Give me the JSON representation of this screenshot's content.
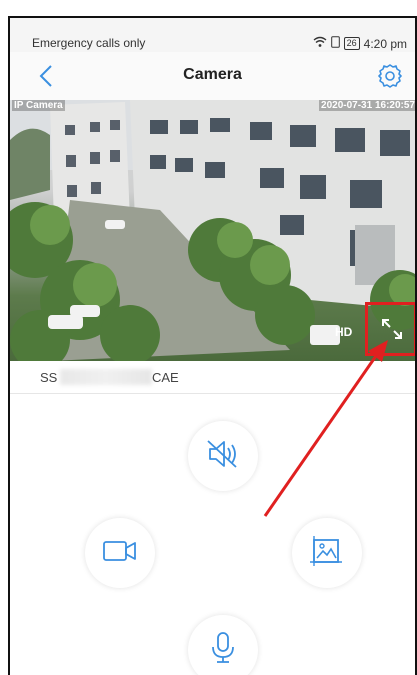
{
  "statusbar": {
    "carrier": "Emergency calls only",
    "battery": "26",
    "time": "4:20 pm"
  },
  "appbar": {
    "title": "Camera"
  },
  "video": {
    "overlay_left": "IP Camera",
    "overlay_right": "2020-07-31 16:20:57",
    "quality": "HD"
  },
  "device": {
    "ssid_prefix": "SS",
    "ssid_suffix": "CAE"
  },
  "icons": {
    "back": "chevron-left-icon",
    "settings": "gear-icon",
    "mute": "speaker-mute-icon",
    "record": "video-camera-icon",
    "snapshot": "image-icon",
    "mic": "microphone-icon",
    "fullscreen": "expand-icon"
  },
  "colors": {
    "accent": "#3a8fe0",
    "annotation": "#e02020"
  }
}
